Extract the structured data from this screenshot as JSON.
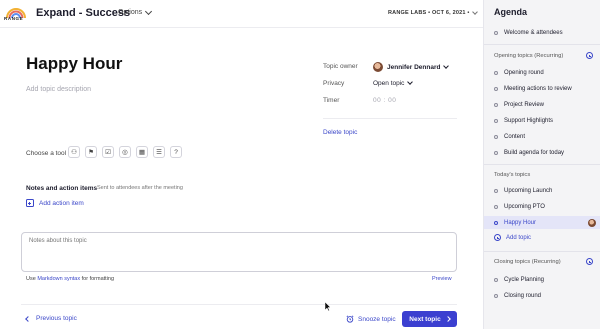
{
  "brand": {
    "logo_text": "RANGE"
  },
  "header": {
    "meeting_title": "Expand - Success",
    "options_label": "Options",
    "org_date": "RANGE LABS • OCT 6, 2021 •"
  },
  "topic": {
    "title": "Happy Hour",
    "description_placeholder": "Add topic description",
    "owner_label": "Topic owner",
    "owner_name": "Jennifer Dennard",
    "privacy_label": "Privacy",
    "privacy_value": "Open topic",
    "timer_label": "Timer",
    "timer_value": "00 : 00",
    "delete_label": "Delete topic"
  },
  "tools": {
    "label": "Choose a tool",
    "items": [
      {
        "icon": "people-icon",
        "glyph": "⚇"
      },
      {
        "icon": "flag-icon",
        "glyph": "⚑"
      },
      {
        "icon": "checkbox-icon",
        "glyph": "☑"
      },
      {
        "icon": "target-icon",
        "glyph": "◎"
      },
      {
        "icon": "calendar-icon",
        "glyph": "▦"
      },
      {
        "icon": "list-icon",
        "glyph": "☰"
      },
      {
        "icon": "question-icon",
        "glyph": "?"
      }
    ]
  },
  "notes": {
    "label": "Notes and action items",
    "sublabel": "Sent to attendees after the meeting",
    "add_action": "Add action item",
    "placeholder": "Notes about this topic",
    "hint_prefix": "Use",
    "hint_link": "Markdown syntax",
    "hint_suffix": "for formatting",
    "preview": "Preview"
  },
  "footer": {
    "prev": "Previous topic",
    "snooze": "Snooze topic",
    "next": "Next topic"
  },
  "sidebar": {
    "title": "Agenda",
    "intro_items": [
      "Welcome & attendees"
    ],
    "opening_section": "Opening topics (Recurring)",
    "opening_items": [
      "Opening round",
      "Meeting actions to review",
      "Project Review",
      "Support Highlights",
      "Content",
      "Build agenda for today"
    ],
    "today_section": "Today's topics",
    "today_items": [
      "Upcoming Launch",
      "Upcoming PTO",
      "Happy Hour"
    ],
    "add_topic": "Add topic",
    "closing_section": "Closing topics (Recurring)",
    "closing_items": [
      "Cycle Planning",
      "Closing round"
    ]
  },
  "colors": {
    "accent": "#3b47c9",
    "primary_button": "#3b3fd0",
    "sidebar_bg": "#f4f4f6",
    "active_item_bg": "#e4e5f8"
  }
}
